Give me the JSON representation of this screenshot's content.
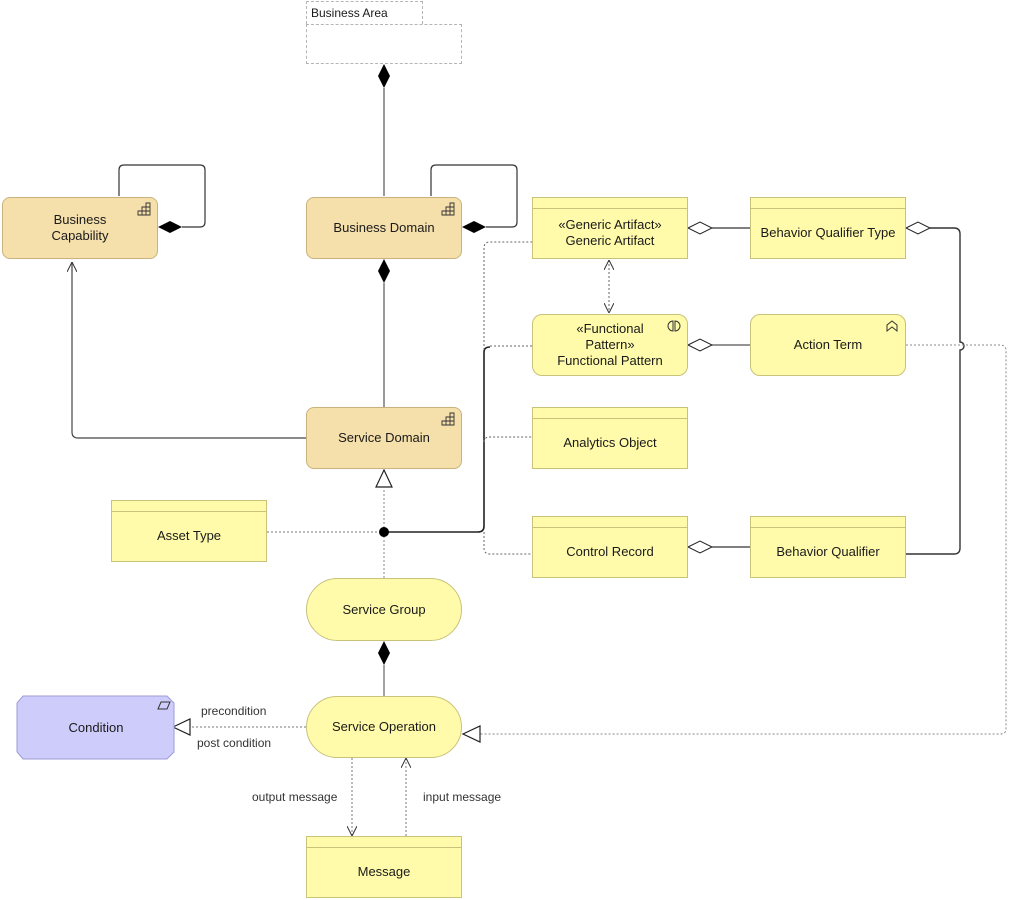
{
  "diagram": {
    "business_area": {
      "label": "Business Area"
    },
    "nodes": {
      "business_capability": {
        "label": "Business\nCapability",
        "type": "capability",
        "icon": "capability-icon"
      },
      "business_domain": {
        "label": "Business Domain",
        "type": "capability",
        "icon": "capability-icon"
      },
      "service_domain": {
        "label": "Service Domain",
        "type": "capability",
        "icon": "capability-icon"
      },
      "generic_artifact": {
        "label": "«Generic Artifact»\nGeneric Artifact",
        "type": "business-object"
      },
      "behavior_qualifier_type": {
        "label": "Behavior Qualifier Type",
        "type": "business-object"
      },
      "functional_pattern": {
        "label": "«Functional\nPattern»\nFunctional Pattern",
        "type": "business-function",
        "icon": "interaction-icon"
      },
      "action_term": {
        "label": "Action Term",
        "type": "business-function",
        "icon": "function-icon"
      },
      "analytics_object": {
        "label": "Analytics Object",
        "type": "business-object"
      },
      "asset_type": {
        "label": "Asset Type",
        "type": "business-object"
      },
      "control_record": {
        "label": "Control Record",
        "type": "business-object"
      },
      "behavior_qualifier": {
        "label": "Behavior Qualifier",
        "type": "business-object"
      },
      "service_group": {
        "label": "Service Group",
        "type": "business-service"
      },
      "service_operation": {
        "label": "Service Operation",
        "type": "business-service"
      },
      "condition": {
        "label": "Condition",
        "type": "requirement",
        "icon": "requirement-icon"
      },
      "message": {
        "label": "Message",
        "type": "business-object"
      }
    },
    "edge_labels": {
      "precondition": "precondition",
      "post_condition": "post condition",
      "output_message": "output message",
      "input_message": "input message"
    },
    "colors": {
      "capability_fill": "#f5dfaa",
      "object_fill": "#fffbaa",
      "requirement_fill": "#cdccfb",
      "line": "#333333"
    }
  }
}
